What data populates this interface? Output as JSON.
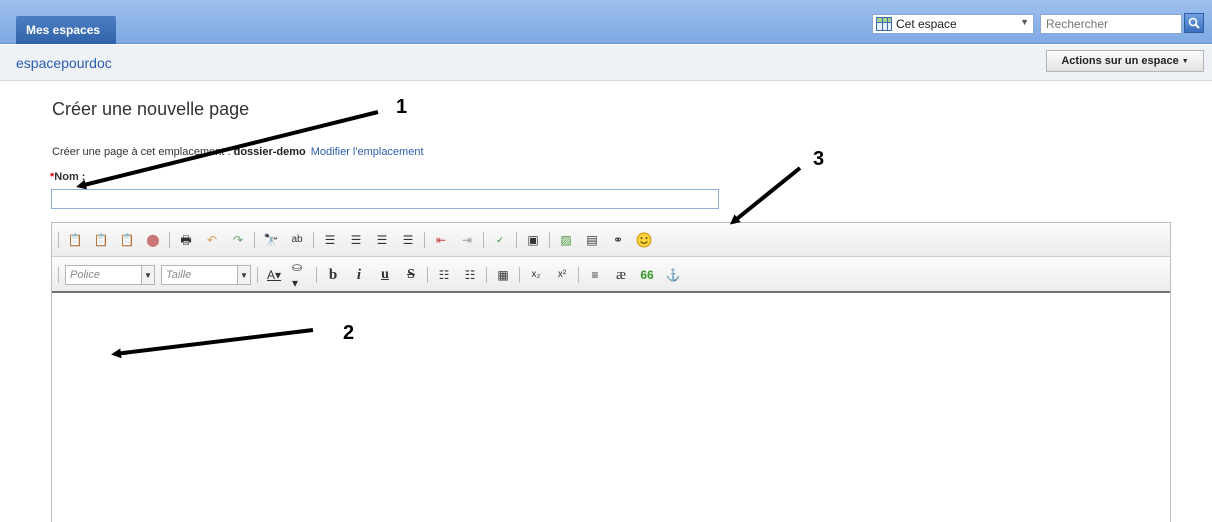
{
  "topbar": {
    "spaces_tab": "Mes espaces",
    "scope_select": "Cet espace",
    "search_placeholder": "Rechercher"
  },
  "subbar": {
    "space_name": "espacepourdoc",
    "actions_button": "Actions sur un espace"
  },
  "form": {
    "page_title": "Créer une nouvelle page",
    "location_prefix": "Créer une page à cet emplacement : ",
    "location_folder": "dossier-demo",
    "modify_link": "Modifier l'emplacement",
    "required_mark": "*",
    "name_label": "Nom :",
    "name_value": ""
  },
  "editor": {
    "font_dropdown": "Police",
    "size_dropdown": "Taille"
  },
  "annotations": {
    "label_1": "1",
    "label_2": "2",
    "label_3": "3"
  },
  "icons": {
    "search": "magnifier-icon",
    "emoticon": "smiley-icon"
  }
}
